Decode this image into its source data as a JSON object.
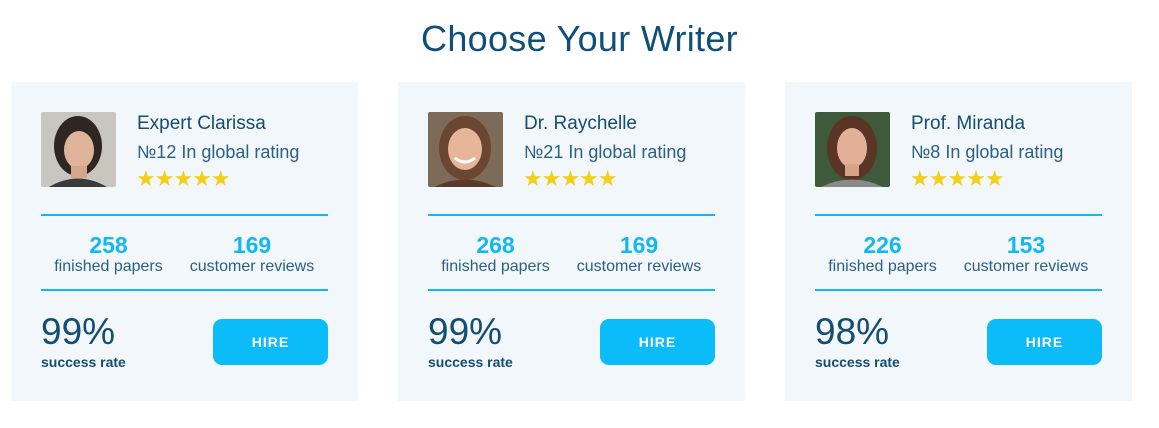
{
  "page": {
    "title": "Choose Your Writer"
  },
  "colors": {
    "title": "#0f4f78",
    "accent": "#0cbcf8",
    "star": "#f2cf1a",
    "card_bg": "#f2f7fb"
  },
  "writers": [
    {
      "name": "Expert Clarissa",
      "rank": "№12 In global rating",
      "stars": "★★★★★",
      "rating_stars": 5,
      "papers_count": "258",
      "papers_label": "finished papers",
      "reviews_count": "169",
      "reviews_label": "customer reviews",
      "success_rate": "99%",
      "success_label": "success rate",
      "hire_label": "HIRE",
      "avatar": "writer-photo-icon"
    },
    {
      "name": "Dr. Raychelle",
      "rank": "№21 In global rating",
      "stars": "★★★★★",
      "rating_stars": 5,
      "papers_count": "268",
      "papers_label": "finished papers",
      "reviews_count": "169",
      "reviews_label": "customer reviews",
      "success_rate": "99%",
      "success_label": "success rate",
      "hire_label": "HIRE",
      "avatar": "writer-photo-icon"
    },
    {
      "name": "Prof. Miranda",
      "rank": "№8 In global rating",
      "stars": "★★★★★",
      "rating_stars": 5,
      "papers_count": "226",
      "papers_label": "finished papers",
      "reviews_count": "153",
      "reviews_label": "customer reviews",
      "success_rate": "98%",
      "success_label": "success rate",
      "hire_label": "HIRE",
      "avatar": "writer-photo-icon"
    }
  ]
}
